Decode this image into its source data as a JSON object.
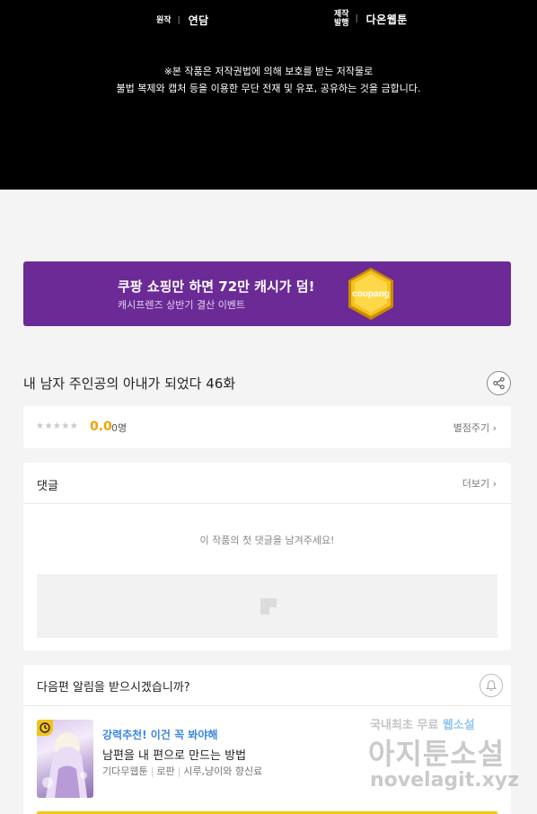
{
  "credits": {
    "original_label": "원작",
    "original_value": "연담",
    "production_label_1": "제작",
    "production_label_2": "발행",
    "production_value": "다온웹툰",
    "copyright_line1": "※본 작품은 저작권법에 의해 보호를 받는 저작물로",
    "copyright_line2": "불법 복제와 캡처 등을 이용한 무단 전재 및 유포, 공유하는 것을 금합니다."
  },
  "banner": {
    "title": "쿠팡 쇼핑만 하면 72만 캐시가 덤!",
    "subtitle": "캐시프렌즈 상반기 결산 이벤트",
    "coin_text": "coupang",
    "color": "#6b2a96"
  },
  "episode": {
    "title": "내 남자 주인공의 아내가 되었다 46화",
    "share_icon": "share-icon"
  },
  "rating": {
    "stars": "★★★★★",
    "score": "0.0",
    "count": "0명",
    "rate_link": "별점주기 ›",
    "score_color": "#f0a300"
  },
  "comments": {
    "title": "댓글",
    "more": "더보기 ›",
    "empty_message": "이 작품의 첫 댓글을 남겨주세요!"
  },
  "notification": {
    "title": "다음편 알림을 받으시겠습니까?",
    "bell_icon": "bell-icon"
  },
  "recommend": {
    "tag": "강력추천! 이건 꼭 봐야해",
    "title": "남편을 내 편으로 만드는 방법",
    "publisher": "기다무웹툰",
    "genre": "로판",
    "author": "시루,냥이와 향신료",
    "tag_color": "#3b86e0"
  },
  "watermark": {
    "line1_a": "국내최초 무료 ",
    "line1_b": "웹소설",
    "line2": "아지툰소설",
    "line3": "novelagit.xyz"
  }
}
